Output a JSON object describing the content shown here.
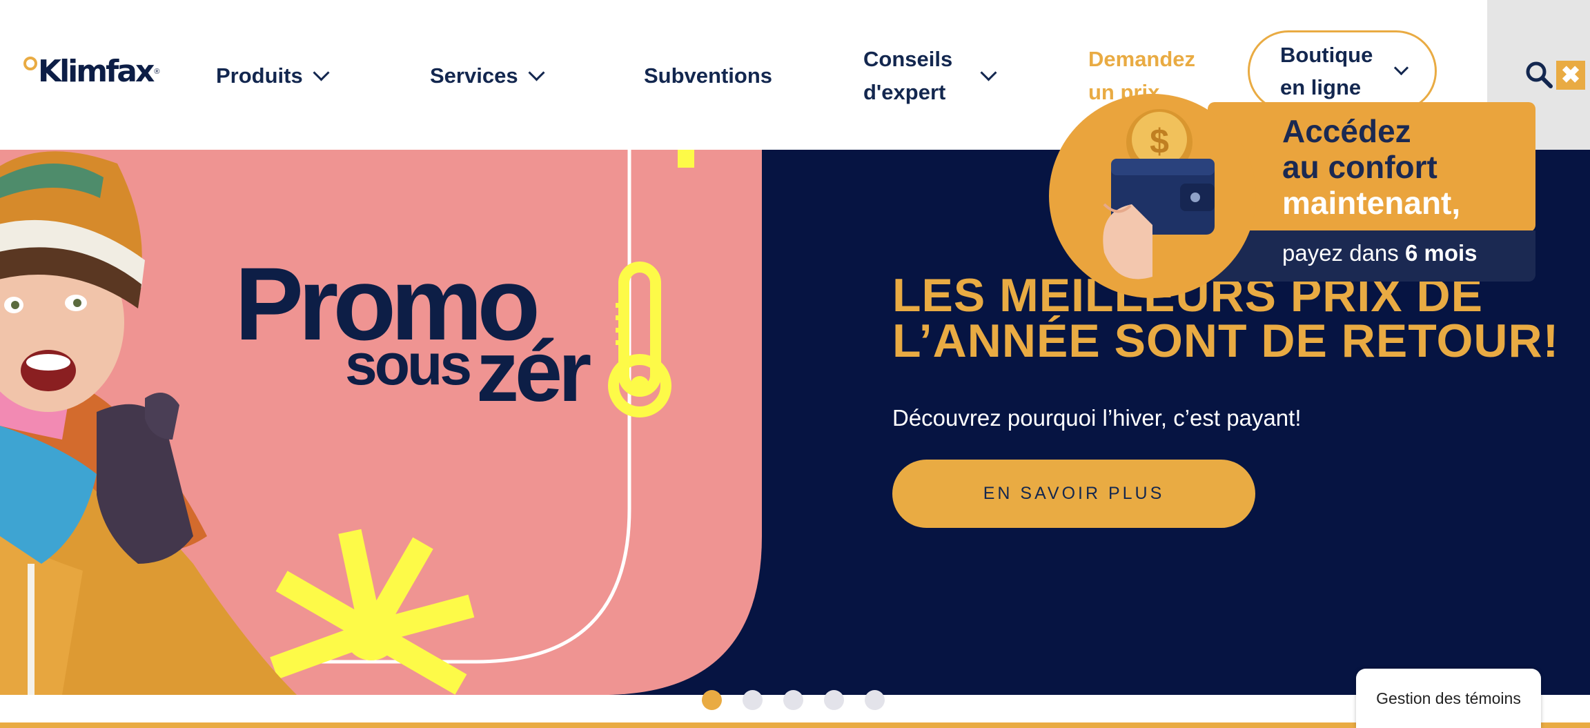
{
  "brand": {
    "name": "Klimfax",
    "trademark": "®"
  },
  "nav": {
    "produits": "Produits",
    "services": "Services",
    "subventions": "Subventions",
    "conseils_line1": "Conseils",
    "conseils_line2": "d'expert",
    "demandez_line1": "Demandez",
    "demandez_line2": "un prix",
    "boutique_line1": "Boutique",
    "boutique_line2": "en ligne"
  },
  "icons": {
    "search": "search-icon",
    "close": "close-icon",
    "chevron": "chevron-down-icon"
  },
  "hero": {
    "promo_word": "Promo",
    "promo_sous": "sous",
    "promo_zero": "zér",
    "headline_line1": "LES MEILLEURS PRIX DE",
    "headline_line2": "L’ANNÉE SONT DE RETOUR!",
    "subtitle": "Découvrez pourquoi l’hiver, c’est payant!",
    "cta": "EN SAVOIR PLUS"
  },
  "carousel": {
    "total_slides": 5,
    "active_index": 0
  },
  "badge": {
    "line1": "Accédez",
    "line2": "au confort",
    "line3": "maintenant,",
    "sub_prefix": "payez dans",
    "sub_bold": "6 mois",
    "coin_symbol": "$"
  },
  "cookie": {
    "label": "Gestion des témoins"
  },
  "colors": {
    "navy": "#061442",
    "brand_text": "#13274f",
    "accent": "#e9ab43",
    "pink_panel": "#ef9492",
    "yellow": "#fdfa48",
    "badge_dark": "#1b2952"
  }
}
